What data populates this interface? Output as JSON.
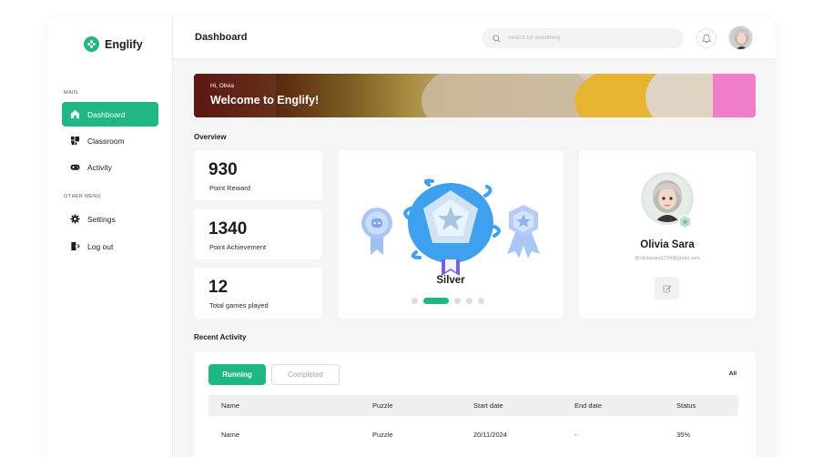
{
  "brand": {
    "name": "Englify",
    "accent": "#1fb784"
  },
  "sidebar": {
    "main_label": "MAIN",
    "items": [
      {
        "label": "Dashboard",
        "icon": "home-icon",
        "active": true
      },
      {
        "label": "Classroom",
        "icon": "classroom-icon",
        "active": false
      },
      {
        "label": "Activity",
        "icon": "gamepad-icon",
        "active": false
      }
    ],
    "other_label": "OTHER MENU",
    "other_items": [
      {
        "label": "Settings",
        "icon": "gear-icon"
      },
      {
        "label": "Log out",
        "icon": "logout-icon"
      }
    ]
  },
  "header": {
    "title": "Dashboard",
    "search_placeholder": "Search for something"
  },
  "banner": {
    "greeting": "Hi, Olivia",
    "title": "Welcome to Englify!"
  },
  "overview": {
    "label": "Overview",
    "stats": [
      {
        "value": "930",
        "label": "Point Reward"
      },
      {
        "value": "1340",
        "label": "Point Achievement"
      },
      {
        "value": "12",
        "label": "Total games played"
      }
    ],
    "badge": {
      "name": "Silver",
      "carousel_count": 5,
      "carousel_active": 1
    },
    "profile": {
      "name": "Olivia Sara",
      "email": "@oliviasara1234@gmail.com"
    }
  },
  "recent_activity": {
    "label": "Recent Activity",
    "tabs": [
      "Running",
      "Completed"
    ],
    "all_label": "All",
    "columns": [
      "Name",
      "Puzzle",
      "Start date",
      "End date",
      "Status"
    ],
    "rows": [
      [
        "Name",
        "Puzzle",
        "20/11/2024",
        "-",
        "35%"
      ]
    ]
  }
}
